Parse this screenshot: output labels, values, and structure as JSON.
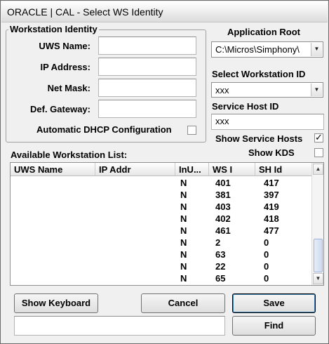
{
  "window": {
    "title": "ORACLE | CAL - Select WS Identity"
  },
  "workstation_identity": {
    "group_label": "Workstation Identity",
    "uws_name_label": "UWS Name:",
    "uws_name_value": "",
    "ip_address_label": "IP Address:",
    "ip_address_value": "",
    "net_mask_label": "Net Mask:",
    "net_mask_value": "",
    "def_gateway_label": "Def. Gateway:",
    "def_gateway_value": "",
    "dhcp_label": "Automatic DHCP Configuration",
    "dhcp_checked": false
  },
  "application_root": {
    "label": "Application Root",
    "value": "C:\\Micros\\Simphony\\"
  },
  "select_workstation": {
    "label": "Select Workstation ID",
    "value": "xxx"
  },
  "service_host": {
    "label": "Service Host ID",
    "value": "xxx"
  },
  "show_service_hosts": {
    "label": "Show Service Hosts",
    "checked": true
  },
  "show_kds": {
    "label": "Show KDS",
    "checked": false
  },
  "workstation_list": {
    "label": "Available Workstation List:",
    "columns": [
      "UWS Name",
      "IP Addr",
      "InU...",
      "WS I",
      "SH Id"
    ],
    "rows": [
      [
        "",
        "",
        "N",
        "401",
        "417"
      ],
      [
        "",
        "",
        "N",
        "381",
        "397"
      ],
      [
        "",
        "",
        "N",
        "403",
        "419"
      ],
      [
        "",
        "",
        "N",
        "402",
        "418"
      ],
      [
        "",
        "",
        "N",
        "461",
        "477"
      ],
      [
        "",
        "",
        "N",
        "2",
        "0"
      ],
      [
        "",
        "",
        "N",
        "63",
        "0"
      ],
      [
        "",
        "",
        "N",
        "22",
        "0"
      ],
      [
        "",
        "",
        "N",
        "65",
        "0"
      ]
    ]
  },
  "buttons": {
    "show_keyboard": "Show Keyboard",
    "cancel": "Cancel",
    "save": "Save",
    "find": "Find"
  },
  "find_input_value": "",
  "icons": {
    "scroll_up": "▲",
    "scroll_down": "▼",
    "combo_arrow": "▼"
  }
}
